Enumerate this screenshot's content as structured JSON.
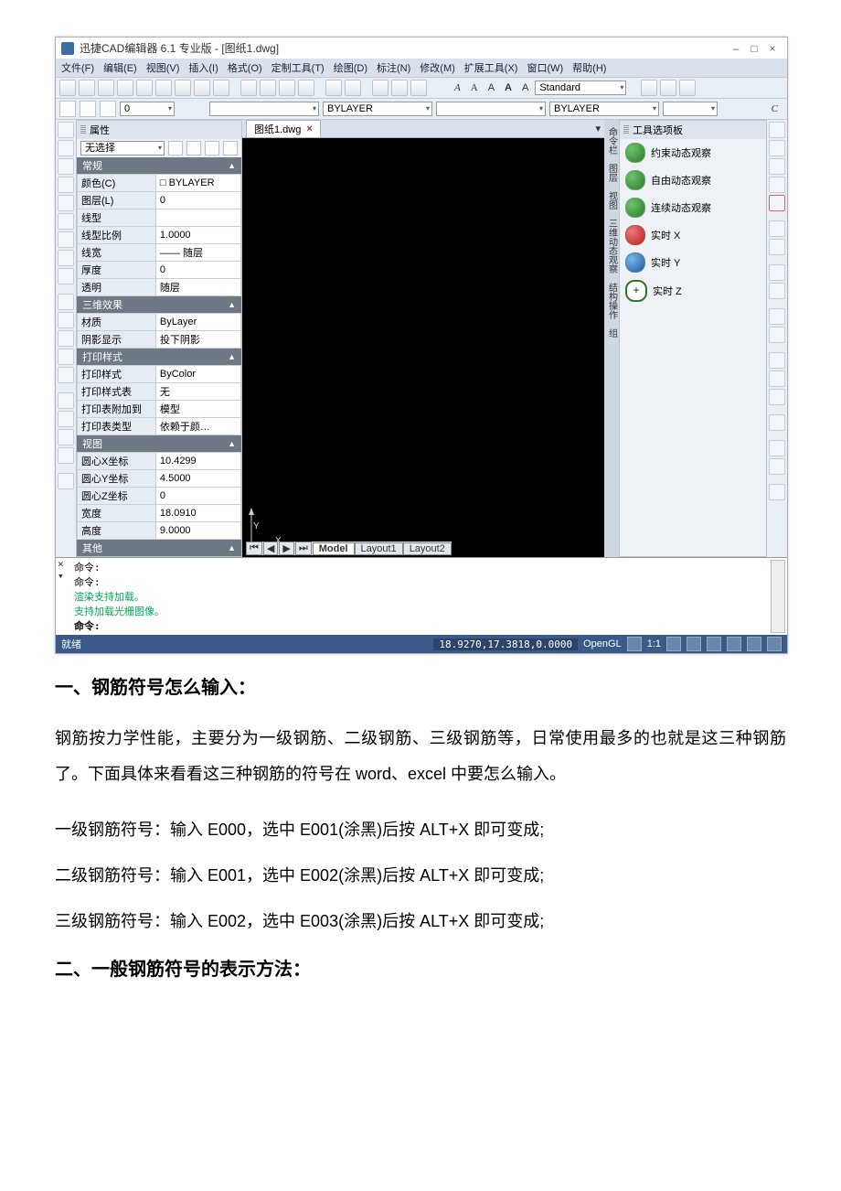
{
  "app": {
    "title": "迅捷CAD编辑器 6.1 专业版 - [图纸1.dwg]",
    "window_buttons": {
      "min": "–",
      "max": "□",
      "close": "×"
    }
  },
  "menu": [
    "文件(F)",
    "编辑(E)",
    "视图(V)",
    "插入(I)",
    "格式(O)",
    "定制工具(T)",
    "绘图(D)",
    "标注(N)",
    "修改(M)",
    "扩展工具(X)",
    "窗口(W)",
    "帮助(H)"
  ],
  "toolbar1": {
    "text_A_group": [
      "A",
      "A",
      "A",
      "A",
      "A"
    ],
    "style_combo": "Standard"
  },
  "toolbar2": {
    "bylayer_center": "BYLAYER",
    "bylayer_right": "BYLAYER"
  },
  "doc_tab": {
    "name": "图纸1.dwg",
    "close": "×",
    "caret": "▾"
  },
  "properties": {
    "title": "属性",
    "selector": "无选择",
    "groups": {
      "general": {
        "label": "常规",
        "rows": [
          {
            "k": "颜色(C)",
            "v": "□ BYLAYER"
          },
          {
            "k": "图层(L)",
            "v": "0"
          },
          {
            "k": "线型",
            "v": ""
          },
          {
            "k": "线型比例",
            "v": "1.0000"
          },
          {
            "k": "线宽",
            "v": "—— 随层"
          },
          {
            "k": "厚度",
            "v": "0"
          },
          {
            "k": "透明",
            "v": "随层"
          }
        ]
      },
      "threeD": {
        "label": "三维效果",
        "rows": [
          {
            "k": "材质",
            "v": "ByLayer"
          },
          {
            "k": "阴影显示",
            "v": "投下阴影"
          }
        ]
      },
      "print": {
        "label": "打印样式",
        "rows": [
          {
            "k": "打印样式",
            "v": "ByColor"
          },
          {
            "k": "打印样式表",
            "v": "无"
          },
          {
            "k": "打印表附加到",
            "v": "模型"
          },
          {
            "k": "打印表类型",
            "v": "依赖于颜…"
          }
        ]
      },
      "view": {
        "label": "视图",
        "rows": [
          {
            "k": "圆心X坐标",
            "v": "10.4299"
          },
          {
            "k": "圆心Y坐标",
            "v": "4.5000"
          },
          {
            "k": "圆心Z坐标",
            "v": "0"
          },
          {
            "k": "宽度",
            "v": "18.0910"
          },
          {
            "k": "高度",
            "v": "9.0000"
          }
        ]
      },
      "other": {
        "label": "其他"
      }
    }
  },
  "canvas": {
    "ucs_x": "X",
    "ucs_y": "Y",
    "model_tabs": {
      "nav": [
        "⏮",
        "◀",
        "▶",
        "⏭"
      ],
      "tabs": [
        "Model",
        "Layout1",
        "Layout2"
      ]
    }
  },
  "side_tabs": [
    "命令栏",
    "图层",
    "视图",
    "三维动态观察",
    "结构操作",
    "组"
  ],
  "toolboard": {
    "title": "工具选项板",
    "items": [
      {
        "label": "约束动态观察",
        "icon": "green"
      },
      {
        "label": "自由动态观察",
        "icon": "green"
      },
      {
        "label": "连续动态观察",
        "icon": "green"
      },
      {
        "label": "实时 X",
        "icon": "red"
      },
      {
        "label": "实时 Y",
        "icon": "blue"
      },
      {
        "label": "实时 Z",
        "icon": "plus"
      }
    ]
  },
  "cmdline": {
    "lines": [
      "命令:",
      "命令:",
      "渲染支持加载。",
      "支持加载光栅图像。",
      "命令:"
    ]
  },
  "status": {
    "left": "就绪",
    "coords": "18.9270,17.3818,0.0000",
    "opengl": "OpenGL",
    "scale": "1:1"
  },
  "article": {
    "h1": "一、钢筋符号怎么输入：",
    "p1": "钢筋按力学性能，主要分为一级钢筋、二级钢筋、三级钢筋等，日常使用最多的也就是这三种钢筋了。下面具体来看看这三种钢筋的符号在 word、excel 中要怎么输入。",
    "l1": "一级钢筋符号：输入 E000，选中 E001(涂黑)后按 ALT+X 即可变成;",
    "l2": "二级钢筋符号：输入 E001，选中 E002(涂黑)后按 ALT+X 即可变成;",
    "l3": "三级钢筋符号：输入 E002，选中 E003(涂黑)后按 ALT+X 即可变成;",
    "h2": "二、一般钢筋符号的表示方法："
  }
}
